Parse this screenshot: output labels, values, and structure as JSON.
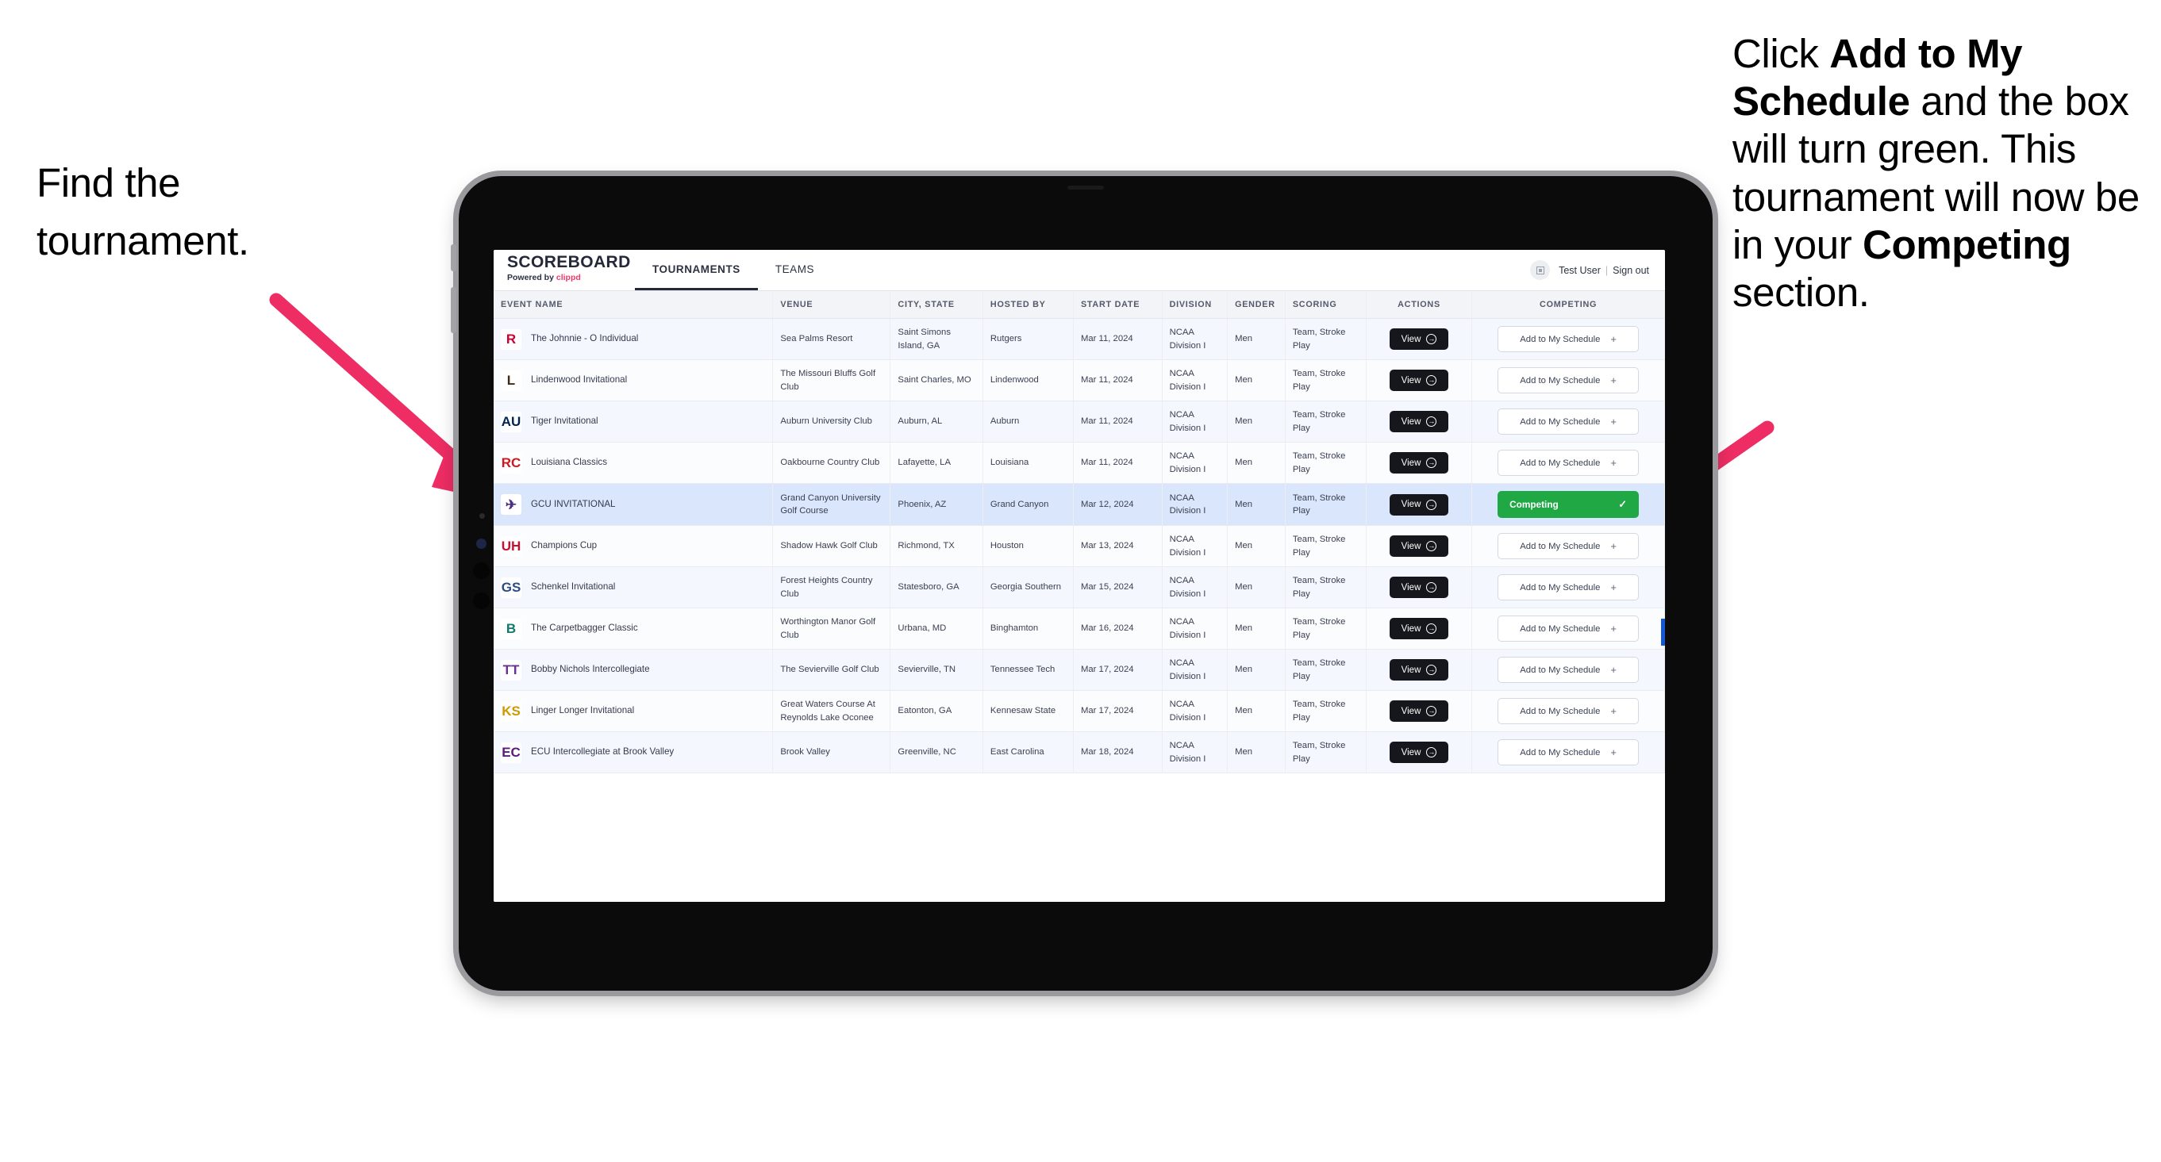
{
  "annotations": {
    "left": [
      "Find the",
      "tournament."
    ],
    "right_parts": [
      {
        "t": "Click ",
        "b": false
      },
      {
        "t": "Add to My Schedule",
        "b": true
      },
      {
        "t": " and the box will turn green. This tournament will now be in your ",
        "b": false
      },
      {
        "t": "Competing",
        "b": true
      },
      {
        "t": " section.",
        "b": false
      }
    ],
    "arrow_color": "#ed2d64"
  },
  "app": {
    "brand": {
      "title": "SCOREBOARD",
      "powered_prefix": "Powered by ",
      "powered_name": "clippd"
    },
    "nav": [
      {
        "label": "TOURNAMENTS",
        "active": true
      },
      {
        "label": "TEAMS",
        "active": false
      }
    ],
    "header_right": {
      "avatar_icon": "user-grid-icon",
      "user": "Test User",
      "separator": "|",
      "signout": "Sign out"
    },
    "table": {
      "columns": [
        "EVENT NAME",
        "VENUE",
        "CITY, STATE",
        "HOSTED BY",
        "START DATE",
        "DIVISION",
        "GENDER",
        "SCORING",
        "ACTIONS",
        "COMPETING"
      ],
      "view_label": "View",
      "add_label": "Add to My Schedule",
      "add_plus": "+",
      "competing_label": "Competing",
      "competing_check": "✓",
      "competing_color": "#1fa844",
      "rows": [
        {
          "logo": {
            "text": "R",
            "color": "#cc0033",
            "bg": "#ffffff"
          },
          "event": "The Johnnie - O Individual",
          "venue": "Sea Palms Resort",
          "city": "Saint Simons Island, GA",
          "hosted_by": "Rutgers",
          "start_date": "Mar 11, 2024",
          "division": "NCAA Division I",
          "gender": "Men",
          "scoring": "Team, Stroke Play",
          "competing": false,
          "selected": false
        },
        {
          "logo": {
            "text": "L",
            "color": "#3b2a14",
            "bg": "#ffffff"
          },
          "event": "Lindenwood Invitational",
          "venue": "The Missouri Bluffs Golf Club",
          "city": "Saint Charles, MO",
          "hosted_by": "Lindenwood",
          "start_date": "Mar 11, 2024",
          "division": "NCAA Division I",
          "gender": "Men",
          "scoring": "Team, Stroke Play",
          "competing": false,
          "selected": false
        },
        {
          "logo": {
            "text": "AU",
            "color": "#03244d",
            "bg": "#ffffff"
          },
          "event": "Tiger Invitational",
          "venue": "Auburn University Club",
          "city": "Auburn, AL",
          "hosted_by": "Auburn",
          "start_date": "Mar 11, 2024",
          "division": "NCAA Division I",
          "gender": "Men",
          "scoring": "Team, Stroke Play",
          "competing": false,
          "selected": false
        },
        {
          "logo": {
            "text": "RC",
            "color": "#ce181e",
            "bg": "#ffffff"
          },
          "event": "Louisiana Classics",
          "venue": "Oakbourne Country Club",
          "city": "Lafayette, LA",
          "hosted_by": "Louisiana",
          "start_date": "Mar 11, 2024",
          "division": "NCAA Division I",
          "gender": "Men",
          "scoring": "Team, Stroke Play",
          "competing": false,
          "selected": false
        },
        {
          "logo": {
            "text": "✈",
            "color": "#4b2e83",
            "bg": "#ffffff"
          },
          "event": "GCU INVITATIONAL",
          "venue": "Grand Canyon University Golf Course",
          "city": "Phoenix, AZ",
          "hosted_by": "Grand Canyon",
          "start_date": "Mar 12, 2024",
          "division": "NCAA Division I",
          "gender": "Men",
          "scoring": "Team, Stroke Play",
          "competing": true,
          "selected": true
        },
        {
          "logo": {
            "text": "UH",
            "color": "#c8102e",
            "bg": "#ffffff"
          },
          "event": "Champions Cup",
          "venue": "Shadow Hawk Golf Club",
          "city": "Richmond, TX",
          "hosted_by": "Houston",
          "start_date": "Mar 13, 2024",
          "division": "NCAA Division I",
          "gender": "Men",
          "scoring": "Team, Stroke Play",
          "competing": false,
          "selected": false
        },
        {
          "logo": {
            "text": "GS",
            "color": "#2b4f81",
            "bg": "#ffffff"
          },
          "event": "Schenkel Invitational",
          "venue": "Forest Heights Country Club",
          "city": "Statesboro, GA",
          "hosted_by": "Georgia Southern",
          "start_date": "Mar 15, 2024",
          "division": "NCAA Division I",
          "gender": "Men",
          "scoring": "Team, Stroke Play",
          "competing": false,
          "selected": false
        },
        {
          "logo": {
            "text": "B",
            "color": "#0f7a6e",
            "bg": "#ffffff"
          },
          "event": "The Carpetbagger Classic",
          "venue": "Worthington Manor Golf Club",
          "city": "Urbana, MD",
          "hosted_by": "Binghamton",
          "start_date": "Mar 16, 2024",
          "division": "NCAA Division I",
          "gender": "Men",
          "scoring": "Team, Stroke Play",
          "competing": false,
          "selected": false
        },
        {
          "logo": {
            "text": "TT",
            "color": "#6b2f8f",
            "bg": "#ffffff"
          },
          "event": "Bobby Nichols Intercollegiate",
          "venue": "The Sevierville Golf Club",
          "city": "Sevierville, TN",
          "hosted_by": "Tennessee Tech",
          "start_date": "Mar 17, 2024",
          "division": "NCAA Division I",
          "gender": "Men",
          "scoring": "Team, Stroke Play",
          "competing": false,
          "selected": false
        },
        {
          "logo": {
            "text": "KS",
            "color": "#cc9900",
            "bg": "#ffffff"
          },
          "event": "Linger Longer Invitational",
          "venue": "Great Waters Course At Reynolds Lake Oconee",
          "city": "Eatonton, GA",
          "hosted_by": "Kennesaw State",
          "start_date": "Mar 17, 2024",
          "division": "NCAA Division I",
          "gender": "Men",
          "scoring": "Team, Stroke Play",
          "competing": false,
          "selected": false
        },
        {
          "logo": {
            "text": "EC",
            "color": "#5c1a7a",
            "bg": "#ffffff"
          },
          "event": "ECU Intercollegiate at Brook Valley",
          "venue": "Brook Valley",
          "city": "Greenville, NC",
          "hosted_by": "East Carolina",
          "start_date": "Mar 18, 2024",
          "division": "NCAA Division I",
          "gender": "Men",
          "scoring": "Team, Stroke Play",
          "competing": false,
          "selected": false
        }
      ]
    }
  }
}
